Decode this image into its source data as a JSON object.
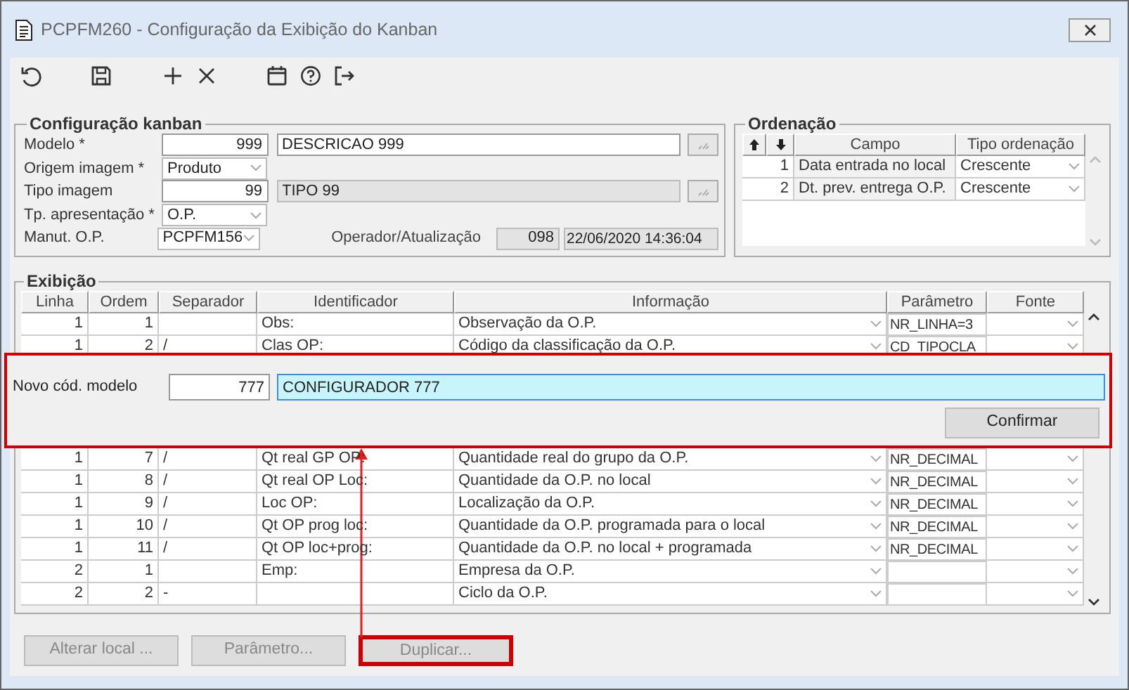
{
  "window": {
    "title": "PCPFM260 - Configuração da Exibição do Kanban"
  },
  "toolbar": [
    {
      "kind": "undo"
    },
    {
      "kind": "save"
    },
    {
      "kind": "add"
    },
    {
      "kind": "delete"
    },
    {
      "kind": "calendar"
    },
    {
      "kind": "help"
    },
    {
      "kind": "exit"
    }
  ],
  "config": {
    "legend": "Configuração kanban",
    "fields": [
      {
        "kind": "lookup",
        "label": "Modelo *",
        "code": "999",
        "description": "DESCRICAO 999",
        "disabled": false
      },
      {
        "kind": "select",
        "label": "Origem imagem *",
        "value": "Produto"
      },
      {
        "kind": "lookup",
        "label": "Tipo imagem",
        "code": "99",
        "description": "TIPO 99",
        "disabled": true
      },
      {
        "kind": "select",
        "label": "Tp. apresentação *",
        "value": "O.P."
      },
      {
        "kind": "select",
        "label": "Manut. O.P.",
        "value": "PCPFM156"
      }
    ],
    "operator": {
      "label": "Operador/Atualização",
      "code": "098",
      "timestamp": "22/06/2020 14:36:04"
    }
  },
  "ordering": {
    "legend": "Ordenação",
    "columns": [
      "Campo",
      "Tipo ordenação"
    ],
    "rows": [
      {
        "seq": "1",
        "field": "Data entrada no local",
        "order": "Crescente"
      },
      {
        "seq": "2",
        "field": "Dt. prev. entrega O.P.",
        "order": "Crescente"
      }
    ]
  },
  "display": {
    "legend": "Exibição",
    "columns": [
      "Linha",
      "Ordem",
      "Separador",
      "Identificador",
      "Informação",
      "Parâmetro",
      "Fonte"
    ],
    "rows": [
      {
        "line": "1",
        "order": "1",
        "identifier": "Obs:",
        "information": "Observação da O.P.",
        "parameter": "NR_LINHA=3"
      },
      {
        "line": "1",
        "order": "2",
        "separator": "/",
        "identifier": "Clas OP:",
        "information": "Código da classificação da O.P.",
        "parameter": "CD_TIPOCLA"
      },
      {
        "line": "1",
        "order": "7",
        "separator": "/",
        "identifier": "Qt real GP OP:",
        "information": "Quantidade real do grupo da O.P.",
        "parameter": "NR_DECIMAL"
      },
      {
        "line": "1",
        "order": "8",
        "separator": "/",
        "identifier": "Qt real OP Loc:",
        "information": "Quantidade da O.P. no local",
        "parameter": "NR_DECIMAL"
      },
      {
        "line": "1",
        "order": "9",
        "separator": "/",
        "identifier": "Loc OP:",
        "information": "Localização da O.P.",
        "parameter": "NR_DECIMAL"
      },
      {
        "line": "1",
        "order": "10",
        "separator": "/",
        "identifier": "Qt OP prog loc:",
        "information": "Quantidade da O.P. programada para o local",
        "parameter": "NR_DECIMAL"
      },
      {
        "line": "1",
        "order": "11",
        "separator": "/",
        "identifier": "Qt OP loc+prog:",
        "information": "Quantidade da O.P. no local + programada",
        "parameter": "NR_DECIMAL"
      },
      {
        "line": "2",
        "order": "1",
        "identifier": "Emp:",
        "information": "Empresa da O.P."
      },
      {
        "line": "2",
        "order": "2",
        "separator": "-",
        "information": "Ciclo da O.P."
      }
    ]
  },
  "buttons": [
    {
      "label": "Alterar local ...",
      "disabled": true,
      "highlighted": false
    },
    {
      "label": "Parâmetro...",
      "disabled": true,
      "highlighted": false
    },
    {
      "label": "Duplicar...",
      "disabled": true,
      "highlighted": true
    }
  ],
  "dialog": {
    "label": "Novo cód. modelo",
    "code": "777",
    "name": "CONFIGURADOR 777",
    "button": "Confirmar",
    "highlighted": true
  }
}
